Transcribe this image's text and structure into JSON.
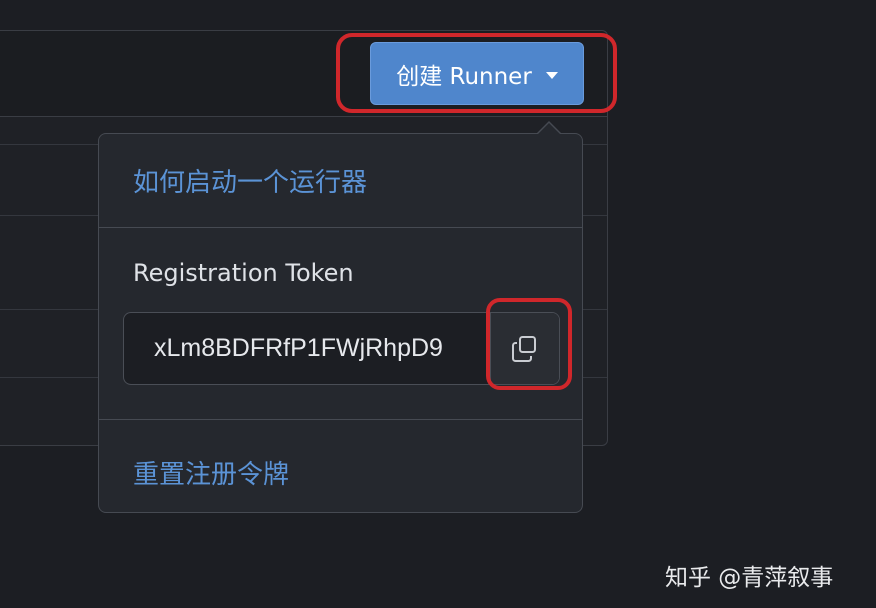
{
  "header": {
    "create_button_label": "创建 Runner",
    "create_button_icon": "caret-down-icon"
  },
  "dropdown": {
    "how_to_link": "如何启动一个运行器",
    "token_label": "Registration Token",
    "token_value": "xLm8BDFRfP1FWjRhpD9",
    "copy_icon": "copy-icon",
    "reset_link": "重置注册令牌"
  },
  "watermark": "知乎 @青萍叙事",
  "colors": {
    "accent": "#4f86cc",
    "link": "#5b93d6",
    "highlight": "#d0272b",
    "background": "#1c1e23"
  }
}
